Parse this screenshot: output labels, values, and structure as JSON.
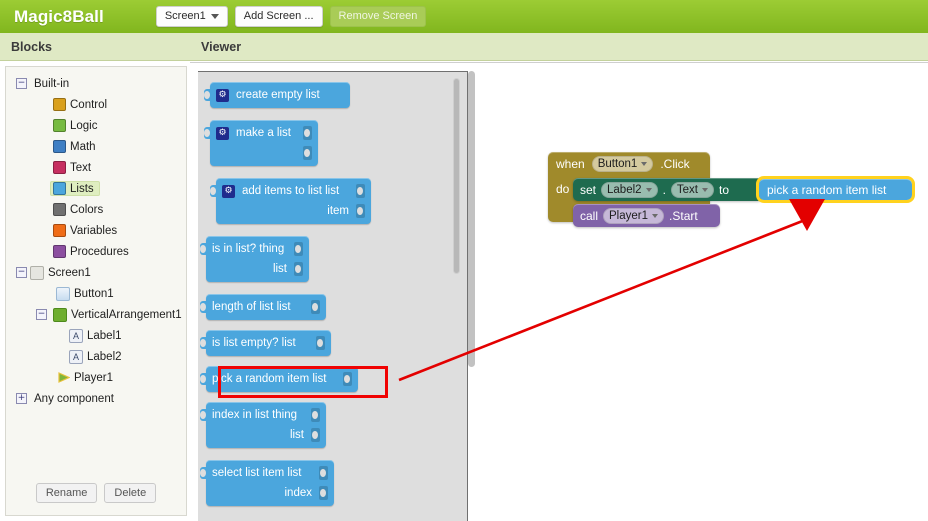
{
  "header": {
    "app_title": "Magic8Ball",
    "screen_selector": {
      "label": "Screen1",
      "icon": "chevron-down-icon"
    },
    "add_screen_label": "Add Screen ...",
    "remove_screen_label": "Remove Screen"
  },
  "panels": {
    "blocks_title": "Blocks",
    "viewer_title": "Viewer"
  },
  "tree": {
    "builtin": {
      "label": "Built-in",
      "expander": "−"
    },
    "builtin_items": [
      {
        "label": "Control",
        "color": "#d9a01d",
        "selected": false
      },
      {
        "label": "Logic",
        "color": "#77bb41",
        "selected": false
      },
      {
        "label": "Math",
        "color": "#3f7fc4",
        "selected": false
      },
      {
        "label": "Text",
        "color": "#c62f60",
        "selected": false
      },
      {
        "label": "Lists",
        "color": "#4ba6dd",
        "selected": true
      },
      {
        "label": "Colors",
        "color": "#707070",
        "selected": false
      },
      {
        "label": "Variables",
        "color": "#ef6c17",
        "selected": false
      },
      {
        "label": "Procedures",
        "color": "#8c4fa0",
        "selected": false
      }
    ],
    "screen1": {
      "label": "Screen1",
      "expander": "−",
      "icon": "screen-icon"
    },
    "components": [
      {
        "label": "Button1",
        "icon": "button-icon",
        "indent": 47,
        "expander": null
      },
      {
        "label": "VerticalArrangement1",
        "icon": "layout-icon",
        "indent": 30,
        "expander": "−"
      },
      {
        "label": "Label1",
        "icon": "label-icon",
        "indent": 60,
        "expander": null
      },
      {
        "label": "Label2",
        "icon": "label-icon",
        "indent": 60,
        "expander": null
      },
      {
        "label": "Player1",
        "icon": "player-icon",
        "indent": 47,
        "expander": null
      }
    ],
    "any_component": {
      "label": "Any component",
      "expander": "+"
    },
    "rename_label": "Rename",
    "delete_label": "Delete"
  },
  "flyout": {
    "blocks": [
      {
        "name": "create-empty-list-block",
        "mutator": true,
        "lines": [
          "create empty list"
        ],
        "sockets": [
          false
        ]
      },
      {
        "name": "make-a-list-block",
        "mutator": true,
        "lines": [
          "make a list",
          ""
        ],
        "sockets": [
          true,
          true
        ]
      },
      {
        "name": "add-items-to-list-block",
        "mutator": true,
        "lines": [
          "add items to list    list",
          "item"
        ],
        "sockets": [
          true,
          true
        ]
      },
      {
        "name": "is-in-list-block",
        "mutator": false,
        "lines": [
          "is in list? thing",
          "list"
        ],
        "sockets": [
          true,
          true
        ]
      },
      {
        "name": "length-of-list-block",
        "mutator": false,
        "lines": [
          "length of list   list"
        ],
        "sockets": [
          true
        ]
      },
      {
        "name": "is-list-empty-block",
        "mutator": false,
        "lines": [
          "is list empty?  list"
        ],
        "sockets": [
          true
        ]
      },
      {
        "name": "pick-a-random-item-block",
        "mutator": false,
        "lines": [
          "pick a random item   list"
        ],
        "sockets": [
          true
        ],
        "highlighted": true
      },
      {
        "name": "index-in-list-block",
        "mutator": false,
        "lines": [
          "index in list  thing",
          "list"
        ],
        "sockets": [
          true,
          true
        ]
      },
      {
        "name": "select-list-item-block",
        "mutator": false,
        "lines": [
          "select list item  list",
          "index"
        ],
        "sockets": [
          true,
          true
        ]
      }
    ]
  },
  "workspace": {
    "event_block": {
      "when_label": "when",
      "component": "Button1",
      "event": ".Click",
      "do_label": "do",
      "color": "#a08a2b"
    },
    "set_block": {
      "set_label": "set",
      "component": "Label2",
      "dot": ".",
      "property": "Text",
      "to_label": "to",
      "color": "#1e6b4f"
    },
    "call_block": {
      "call_label": "call",
      "component": "Player1",
      "method": ".Start",
      "color": "#8063a8"
    },
    "value_block": {
      "label": "pick a random item   list",
      "color": "#4ba6dd",
      "highlight_color": "#ffd21e"
    }
  },
  "annotation": {
    "arrow_color": "#e30000",
    "box_color": "#f00202"
  }
}
